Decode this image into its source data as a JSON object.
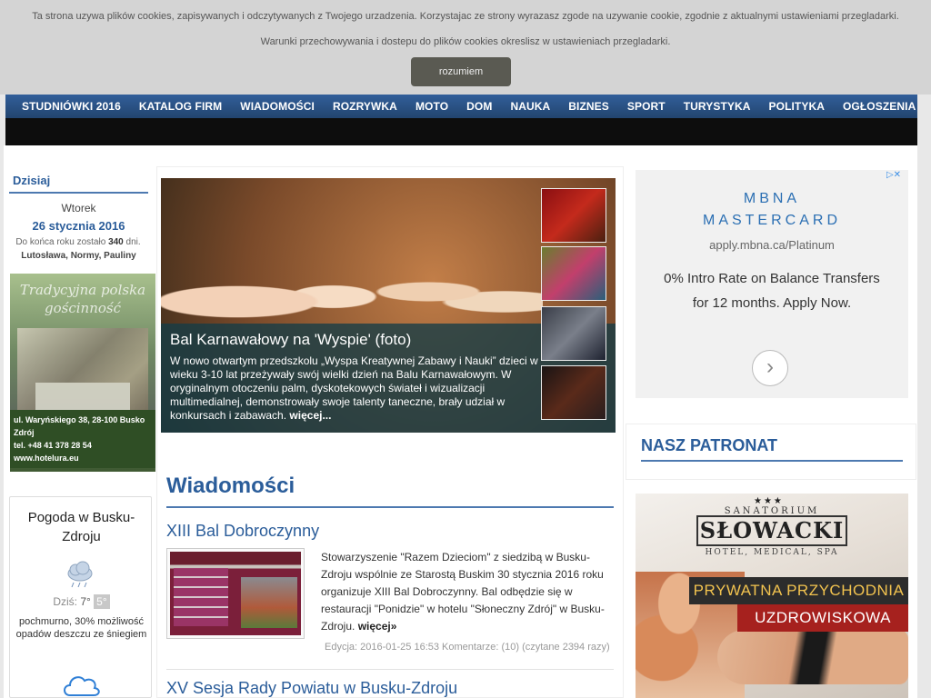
{
  "cookie": {
    "text": "Ta strona uzywa plików cookies, zapisywanych i odczytywanych z Twojego urzadzenia. Korzystajac ze strony wyrazasz zgode na uzywanie cookie, zgodnie z aktualnymi ustawieniami przegladarki. Warunki przechowywania i dostepu do plików cookies okreslisz w ustawieniach przegladarki.",
    "button": "rozumiem"
  },
  "nav": {
    "items": [
      "STUDNIÓWKI 2016",
      "KATALOG FIRM",
      "WIADOMOŚCI",
      "ROZRYWKA",
      "MOTO",
      "DOM",
      "NAUKA",
      "BIZNES",
      "SPORT",
      "TURYSTYKA",
      "POLITYKA",
      "OGŁOSZENIA"
    ]
  },
  "today": {
    "title": "Dzisiaj",
    "weekday": "Wtorek",
    "date": "26 stycznia 2016",
    "left_prefix": "Do końca roku zostało",
    "left_days": "340",
    "left_suffix": "dni.",
    "names": "Lutosława, Normy, Pauliny"
  },
  "hotel_ad": {
    "script": "Tradycyjna polska gościnność",
    "address": "ul. Waryńskiego 38, 28-100 Busko Zdrój",
    "contact": "tel. +48 41 378 28 54  www.hotelura.eu"
  },
  "weather": {
    "title": "Pogoda w Busku-Zdroju",
    "today_label": "Dziś:",
    "temp_day": "7°",
    "temp_night": "5°",
    "desc": "pochmurno, 30% możliwość opadów deszczu ze śniegiem",
    "icon": "cloud-icon"
  },
  "feature": {
    "title": "Bal Karnawałowy na 'Wyspie' (foto)",
    "text": "W nowo otwartym przedszkolu „Wyspa Kreatywnej Zabawy i Nauki” dzieci w wieku 3-10 lat przeżywały swój wielki dzień na Balu Karnawałowym. W oryginalnym otoczeniu palm, dyskotekowych świateł i wizualizacji multimedialnej, demonstrowały swoje talenty taneczne, brały udział w konkursach i zabawach.",
    "more": "więcej..."
  },
  "news": {
    "section_title": "Wiadomości",
    "articles": [
      {
        "title": "XIII Bal Dobroczynny",
        "body": "Stowarzyszenie \"Razem Dzieciom\" z siedzibą w Busku-Zdroju wspólnie ze Starostą Buskim 30 stycznia 2016 roku organizuje XIII Bal Dobroczynny. Bal odbędzie się w restauracji \"Ponidzie\" w hotelu \"Słoneczny Zdrój\" w Busku-Zdroju.",
        "more": "więcej»",
        "meta": "Edycja: 2016-01-25 16:53 Komentarze: (10)  (czytane 2394 razy)"
      },
      {
        "title": "XV Sesja Rady Powiatu w Busku-Zdroju"
      }
    ]
  },
  "ad_mbna": {
    "brand_line1": "MBNA",
    "brand_line2": "MASTERCARD",
    "url": "apply.mbna.ca/Platinum",
    "text": "0% Intro Rate on Balance Transfers for 12 months. Apply Now.",
    "arrow": "›"
  },
  "patronat": {
    "title": "NASZ PATRONAT"
  },
  "ad_sanatorium": {
    "stars": "★★★",
    "sanatorium": "SANATORIUM",
    "name": "SŁOWACKI",
    "tagline": "HOTEL, MEDICAL, SPA",
    "band1": "PRYWATNA PRZYCHODNIA",
    "band2": "UZDROWISKOWA"
  }
}
